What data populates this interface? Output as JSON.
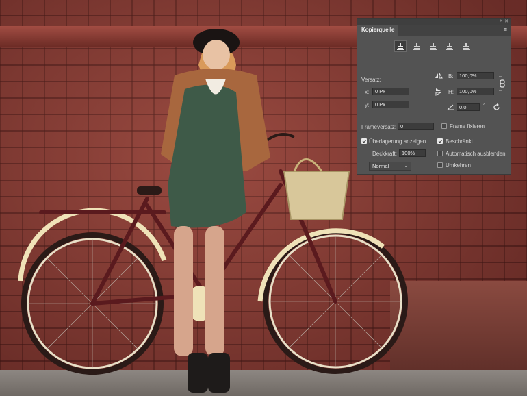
{
  "panel": {
    "tab_label": "Kopierquelle",
    "collapse_glyph": "«",
    "close_glyph": "✕",
    "menu_glyph": "≡",
    "source_buttons": [
      {
        "name": "clone-source-1",
        "active": true
      },
      {
        "name": "clone-source-2",
        "active": false
      },
      {
        "name": "clone-source-3",
        "active": false
      },
      {
        "name": "clone-source-4",
        "active": false
      },
      {
        "name": "clone-source-5",
        "active": false
      }
    ],
    "offset": {
      "label": "Versatz:",
      "x_label": "x:",
      "x_value": "0 Px",
      "y_label": "y:",
      "y_value": "0 Px"
    },
    "scale": {
      "b_label": "B:",
      "b_value": "100,0%",
      "h_label": "H:",
      "h_value": "100,0%"
    },
    "angle": {
      "value": "0,0",
      "unit": "°"
    },
    "frame_offset": {
      "label": "Frameversatz:",
      "value": "0"
    },
    "lock_frame_label": "Frame fixieren",
    "show_overlay_label": "Überlagerung anzeigen",
    "clipped_label": "Beschränkt",
    "opacity_label": "Deckkraft:",
    "opacity_value": "100%",
    "auto_hide_label": "Automatisch ausblenden",
    "blend_mode": "Normal",
    "invert_label": "Umkehren",
    "checkboxes": {
      "lock_frame": false,
      "show_overlay": true,
      "clipped": true,
      "auto_hide": false,
      "invert": false
    },
    "colors": {
      "panel_bg": "#535353",
      "field_bg": "#3c3c3c",
      "text": "#d6d6d6"
    }
  }
}
